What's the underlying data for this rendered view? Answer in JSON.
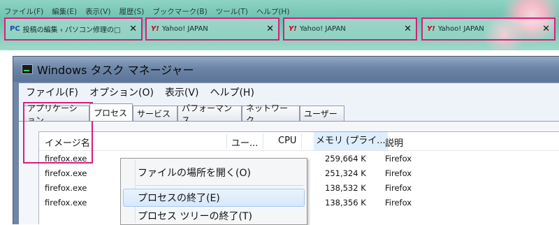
{
  "firefox": {
    "menu": [
      "ファイル(F)",
      "編集(E)",
      "表示(V)",
      "履歴(S)",
      "ブックマーク(B)",
      "ツール(T)",
      "ヘルプ(H)"
    ],
    "tabs": [
      {
        "favicon": "PC",
        "title": "投稿の編集 ‹ パソコン修理の□",
        "close": "✕"
      },
      {
        "favicon": "Y!",
        "title": "Yahoo! JAPAN",
        "close": "✕"
      },
      {
        "favicon": "Y!",
        "title": "Yahoo! JAPAN",
        "close": "✕"
      },
      {
        "favicon": "Y!",
        "title": "Yahoo! JAPAN",
        "close": "✕"
      }
    ],
    "highlight_color": "#d81e7a"
  },
  "taskmanager": {
    "title": "Windows タスク マネージャー",
    "menu": [
      "ファイル(F)",
      "オプション(O)",
      "表示(V)",
      "ヘルプ(H)"
    ],
    "tabs": [
      "アプリケーション",
      "プロセス",
      "サービス",
      "パフォーマンス",
      "ネットワーク",
      "ユーザー"
    ],
    "active_tab": "プロセス",
    "columns": [
      "イメージ名",
      "ユー...",
      "CPU",
      "メモリ (プライ...",
      "説明"
    ],
    "rows": [
      {
        "image": "firefox.exe",
        "memory": "259,664 K",
        "desc": "Firefox"
      },
      {
        "image": "firefox.exe",
        "memory": "251,324 K",
        "desc": "Firefox"
      },
      {
        "image": "firefox.exe",
        "memory": "138,532 K",
        "desc": "Firefox"
      },
      {
        "image": "firefox.exe",
        "memory": "138,356 K",
        "desc": "Firefox"
      }
    ]
  },
  "context_menu": {
    "items": [
      "ファイルの場所を開く(O)",
      "プロセスの終了(E)",
      "プロセス ツリーの終了(T)"
    ],
    "highlighted": "プロセスの終了(E)"
  }
}
